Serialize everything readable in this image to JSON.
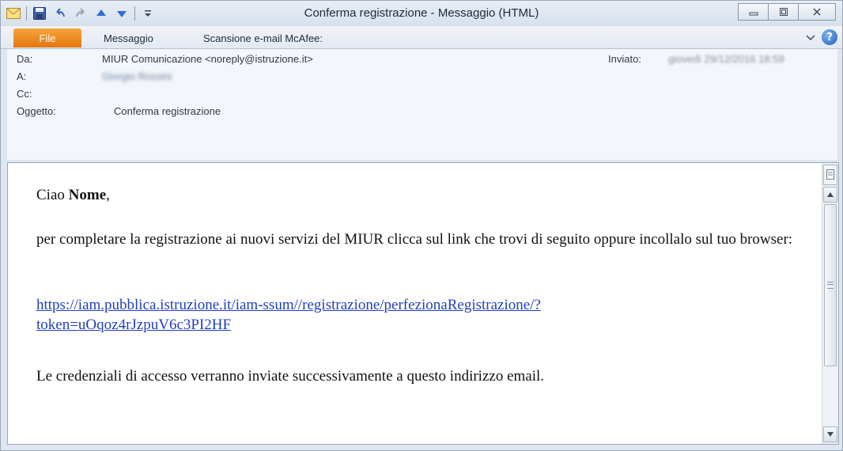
{
  "window": {
    "title": "Conferma registrazione - Messaggio (HTML)"
  },
  "quick_access": {
    "icons": [
      "mail-icon",
      "save-icon",
      "undo-icon",
      "redo-icon",
      "up-arrow-icon",
      "down-arrow-icon",
      "customize-icon"
    ]
  },
  "ribbon": {
    "file_label": "File",
    "tabs": [
      "Messaggio",
      "Scansione e-mail McAfee:"
    ]
  },
  "header": {
    "from_label": "Da:",
    "from_value": "MIUR Comunicazione <noreply@istruzione.it>",
    "to_label": "A:",
    "to_value": "Giorgio Rossini",
    "cc_label": "Cc:",
    "subject_label": "Oggetto:",
    "subject_value": "Conferma registrazione",
    "sent_label": "Inviato:",
    "sent_value": "giovedì 29/12/2016 18:59"
  },
  "message": {
    "greeting_prefix": "Ciao ",
    "greeting_name": "Nome",
    "greeting_suffix": ",",
    "paragraph": "per completare la registrazione ai nuovi servizi del MIUR clicca sul link che trovi di seguito oppure incollalo sul tuo browser:",
    "link_line1": "https://iam.pubblica.istruzione.it/iam-ssum//registrazione/perfezionaRegistrazione/?",
    "link_line2": "token=uOqoz4rJzpuV6c3PI2HF",
    "closing": "Le credenziali di accesso verranno inviate successivamente a questo indirizzo email."
  },
  "colors": {
    "file_tab": "#e4760d",
    "link": "#1f3fbf",
    "title_bar": "#d7e0ec"
  }
}
